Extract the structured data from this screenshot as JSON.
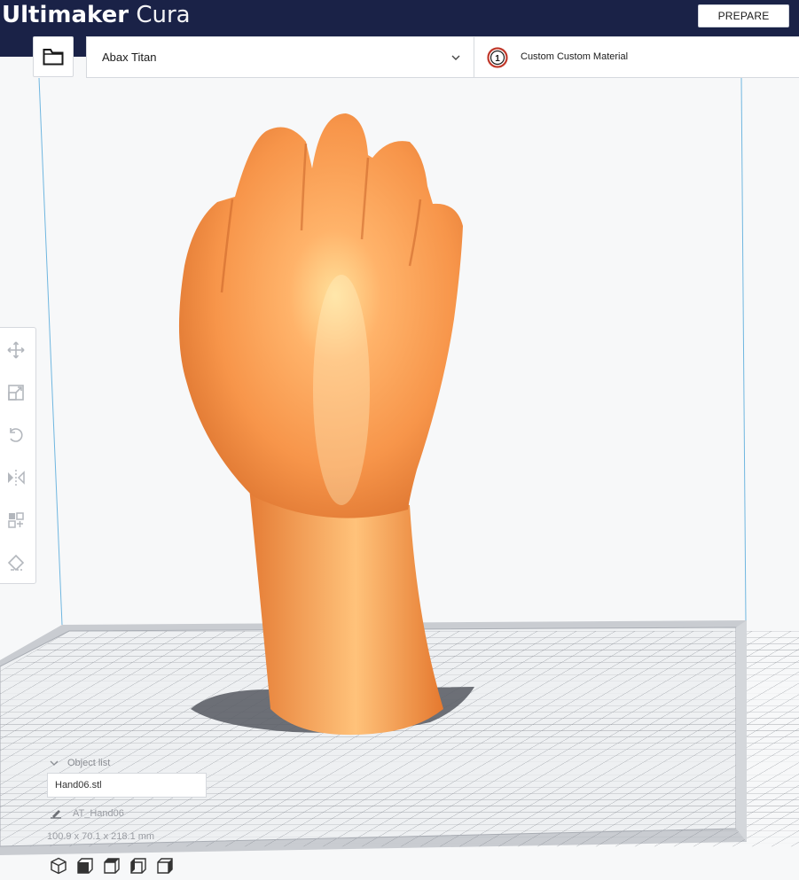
{
  "app": {
    "brand_bold": "Ultimaker",
    "brand_light": "Cura"
  },
  "stage": {
    "prepare_label": "PREPARE"
  },
  "printer": {
    "name": "Abax Titan"
  },
  "material": {
    "extruder_number": "1",
    "name": "Custom Custom Material"
  },
  "tools": [
    "move-tool-icon",
    "scale-tool-icon",
    "rotate-tool-icon",
    "mirror-tool-icon",
    "per-model-settings-icon",
    "support-blocker-icon"
  ],
  "object_list": {
    "header": "Object list",
    "items": [
      "Hand06.stl"
    ],
    "selected_name": "AT_Hand06",
    "dimensions": "100.9 x 70.1 x 218.1 mm"
  },
  "views": [
    "3d-view",
    "front-view",
    "top-view",
    "left-view",
    "right-view"
  ],
  "colors": {
    "header_bg": "#1a2247",
    "model": "#f79e55",
    "accent_badge": "#c0392b"
  }
}
